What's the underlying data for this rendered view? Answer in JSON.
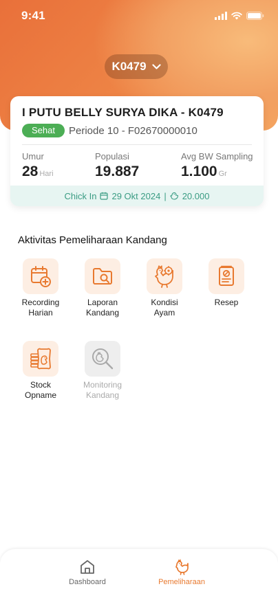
{
  "status_bar": {
    "time": "9:41"
  },
  "farm_selector": {
    "code": "K0479"
  },
  "farm_card": {
    "title": "I PUTU BELLY SURYA DIKA - K0479",
    "status_badge": "Sehat",
    "periode": "Periode 10 - F02670000010",
    "stats": [
      {
        "label": "Umur",
        "value": "28",
        "unit": "Hari"
      },
      {
        "label": "Populasi",
        "value": "19.887",
        "unit": ""
      },
      {
        "label": "Avg BW Sampling",
        "value": "1.100",
        "unit": "Gr"
      }
    ],
    "chick_in_label": "Chick In",
    "chick_in_date": "29 Okt 2024",
    "separator": "|",
    "chick_in_count": "20.000"
  },
  "activities": {
    "title": "Aktivitas Pemeliharaan Kandang",
    "items": [
      {
        "label": "Recording\nHarian",
        "icon": "calendar-add-icon",
        "enabled": true
      },
      {
        "label": "Laporan\nKandang",
        "icon": "folder-search-icon",
        "enabled": true
      },
      {
        "label": "Kondisi\nAyam",
        "icon": "chicken-virus-icon",
        "enabled": true
      },
      {
        "label": "Resep",
        "icon": "prescription-icon",
        "enabled": true
      },
      {
        "label": "Stock\nOpname",
        "icon": "feed-stock-icon",
        "enabled": true
      },
      {
        "label": "Monitoring\nKandang",
        "icon": "monitoring-search-icon",
        "enabled": false
      }
    ]
  },
  "bottom_nav": {
    "items": [
      {
        "label": "Dashboard",
        "icon": "home-icon",
        "active": false
      },
      {
        "label": "Pemeliharaan",
        "icon": "chicken-icon",
        "active": true
      }
    ]
  },
  "colors": {
    "accent": "#e8792f",
    "success": "#4cae55",
    "teal": "#3a9c83"
  }
}
